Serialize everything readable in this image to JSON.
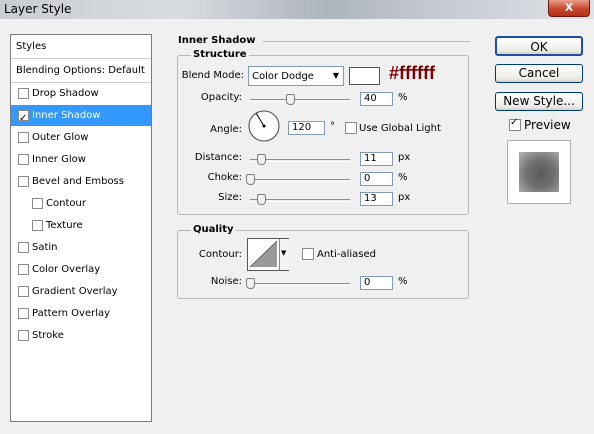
{
  "window": {
    "title": "Layer Style",
    "close_glyph": "X"
  },
  "sidebar": {
    "header": "Styles",
    "blending": "Blending Options: Default",
    "items": [
      {
        "label": "Drop Shadow",
        "checked": false
      },
      {
        "label": "Inner Shadow",
        "checked": true,
        "selected": true
      },
      {
        "label": "Outer Glow",
        "checked": false
      },
      {
        "label": "Inner Glow",
        "checked": false
      },
      {
        "label": "Bevel and Emboss",
        "checked": false
      },
      {
        "label": "Contour",
        "checked": false,
        "indent": true
      },
      {
        "label": "Texture",
        "checked": false,
        "indent": true
      },
      {
        "label": "Satin",
        "checked": false
      },
      {
        "label": "Color Overlay",
        "checked": false
      },
      {
        "label": "Gradient Overlay",
        "checked": false
      },
      {
        "label": "Pattern Overlay",
        "checked": false
      },
      {
        "label": "Stroke",
        "checked": false
      }
    ]
  },
  "panel": {
    "title": "Inner Shadow",
    "structure": {
      "title": "Structure",
      "blend_mode_label": "Blend Mode:",
      "blend_mode_value": "Color Dodge",
      "color": "#ffffff",
      "annotation": "#ffffff",
      "annotation_color": "#7b0000",
      "opacity": {
        "label": "Opacity:",
        "value": "40",
        "unit": "%"
      },
      "angle": {
        "label": "Angle:",
        "value": "120",
        "unit": "°",
        "global_light": "Use Global Light",
        "global_checked": false
      },
      "distance": {
        "label": "Distance:",
        "value": "11",
        "unit": "px"
      },
      "choke": {
        "label": "Choke:",
        "value": "0",
        "unit": "%"
      },
      "size": {
        "label": "Size:",
        "value": "13",
        "unit": "px"
      }
    },
    "quality": {
      "title": "Quality",
      "contour_label": "Contour:",
      "anti_aliased": "Anti-aliased",
      "anti_checked": false,
      "noise": {
        "label": "Noise:",
        "value": "0",
        "unit": "%"
      }
    }
  },
  "buttons": {
    "ok": "OK",
    "cancel": "Cancel",
    "new_style": "New Style...",
    "preview": "Preview",
    "preview_checked": true
  }
}
